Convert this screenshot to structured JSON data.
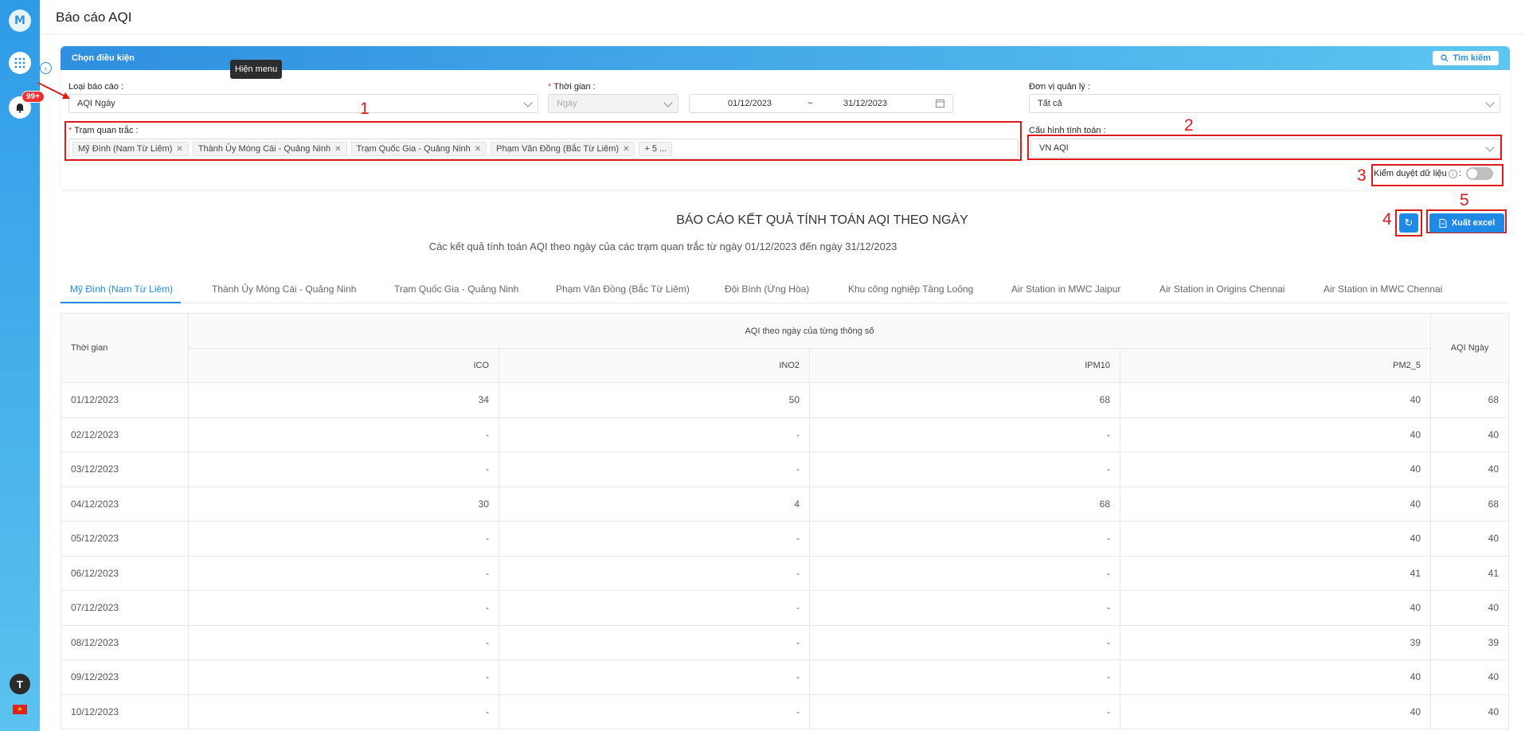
{
  "app": {
    "logo_letter": "M",
    "badge": "99+",
    "avatar_letter": "T",
    "tooltip": "Hiện menu"
  },
  "page": {
    "title": "Báo cáo AQI"
  },
  "filter": {
    "header": "Chọn điều kiện",
    "search_label": "Tìm kiếm",
    "report_type_label": "Loại báo cáo :",
    "report_type_value": "AQI Ngày",
    "time_label": "Thời gian :",
    "time_value": "Ngày",
    "date_from": "01/12/2023",
    "date_sep": "~",
    "date_to": "31/12/2023",
    "unit_label": "Đơn vị quản lý :",
    "unit_value": "Tất cả",
    "station_label": "Trạm quan trắc :",
    "stations": [
      "Mỹ Đình (Nam Từ Liêm)",
      "Thành Ủy Móng Cái - Quảng Ninh",
      "Trạm Quốc Gia - Quảng Ninh",
      "Phạm Văn Đồng (Bắc Từ Liêm)"
    ],
    "more_tag": "+ 5 ...",
    "config_label": "Cấu hình tính toán :",
    "config_value": "VN AQI",
    "verify_label": "Kiểm duyệt dữ liệu",
    "verify_suffix": ":"
  },
  "annotations": [
    "1",
    "2",
    "3",
    "4",
    "5"
  ],
  "report": {
    "title": "BÁO CÁO KẾT QUẢ TÍNH TOÁN AQI THEO NGÀY",
    "subtitle": "Các kết quả tính toán AQI theo ngày của các trạm quan trắc từ ngày 01/12/2023 đến ngày 31/12/2023",
    "export_label": "Xuất excel"
  },
  "tabs": [
    "Mỹ Đình (Nam Từ Liêm)",
    "Thành Ủy Móng Cái - Quảng Ninh",
    "Trạm Quốc Gia - Quảng Ninh",
    "Phạm Văn Đồng (Bắc Từ Liêm)",
    "Đội Bình (Ứng Hòa)",
    "Khu công nghiệp Tầng Loỏng",
    "Air Station in MWC Jaipur",
    "Air Station in Origins Chennai",
    "Air Station in MWC Chennai"
  ],
  "table": {
    "col_time": "Thời gian",
    "col_group": "AQI theo ngày của từng thông số",
    "col_params": [
      "ICO",
      "INO2",
      "IPM10",
      "PM2_5"
    ],
    "col_day": "AQI Ngày",
    "rows": [
      [
        "01/12/2023",
        "34",
        "50",
        "68",
        "40",
        "68"
      ],
      [
        "02/12/2023",
        "-",
        "-",
        "-",
        "40",
        "40"
      ],
      [
        "03/12/2023",
        "-",
        "-",
        "-",
        "40",
        "40"
      ],
      [
        "04/12/2023",
        "30",
        "4",
        "68",
        "40",
        "68"
      ],
      [
        "05/12/2023",
        "-",
        "-",
        "-",
        "40",
        "40"
      ],
      [
        "06/12/2023",
        "-",
        "-",
        "-",
        "41",
        "41"
      ],
      [
        "07/12/2023",
        "-",
        "-",
        "-",
        "40",
        "40"
      ],
      [
        "08/12/2023",
        "-",
        "-",
        "-",
        "39",
        "39"
      ],
      [
        "09/12/2023",
        "-",
        "-",
        "-",
        "40",
        "40"
      ],
      [
        "10/12/2023",
        "-",
        "-",
        "-",
        "40",
        "40"
      ]
    ]
  }
}
